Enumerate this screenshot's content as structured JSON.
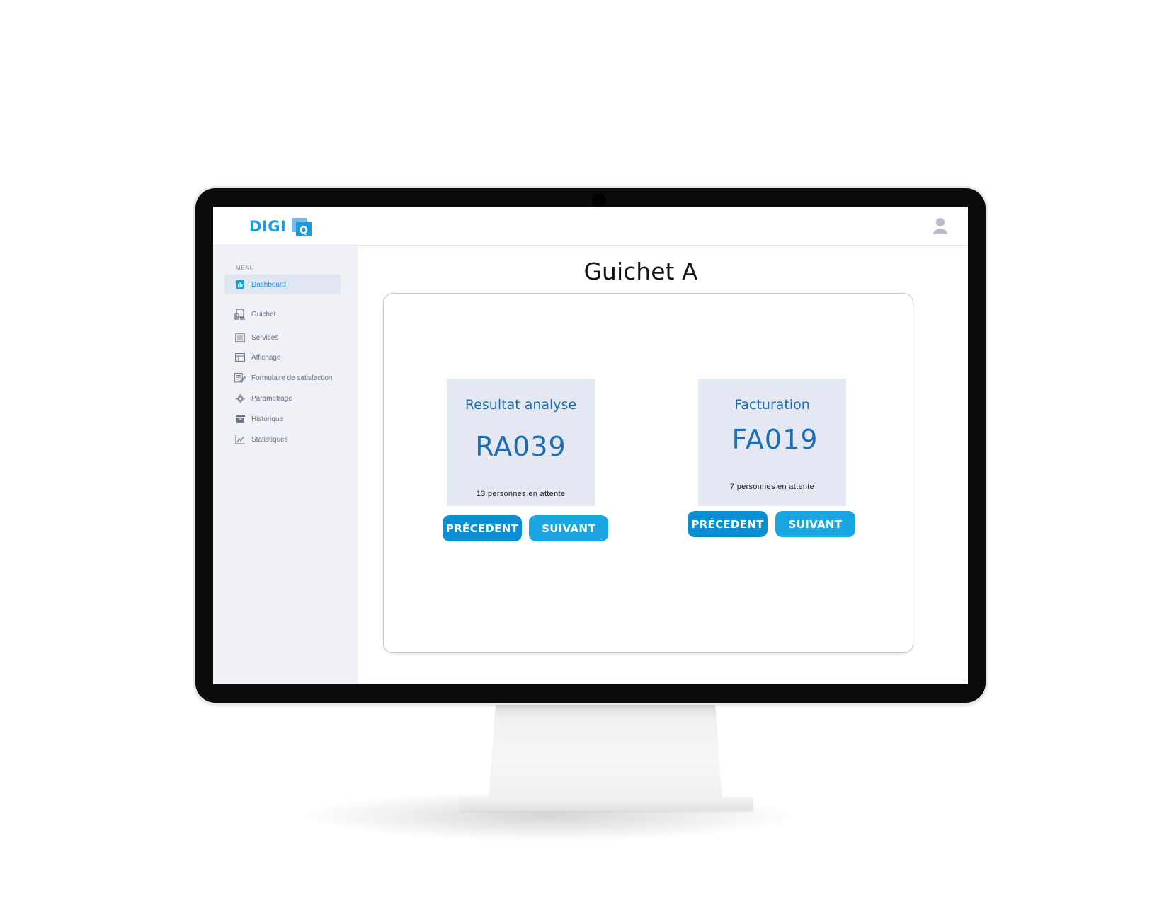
{
  "brand": {
    "name": "DIGI",
    "mark_letter": "Q",
    "color": "#1b9be0"
  },
  "sidebar": {
    "menu_heading": "MENU",
    "items": [
      {
        "label": "Dashboard",
        "icon": "dashboard-icon",
        "active": true
      },
      {
        "label": "Guichet",
        "icon": "kiosk-icon",
        "active": false
      },
      {
        "label": "Services",
        "icon": "list-icon",
        "active": false
      },
      {
        "label": "Affichage",
        "icon": "display-icon",
        "active": false
      },
      {
        "label": "Formulaire de satisfaction",
        "icon": "form-icon",
        "active": false
      },
      {
        "label": "Parametrage",
        "icon": "gear-icon",
        "active": false
      },
      {
        "label": "Historique",
        "icon": "archive-icon",
        "active": false
      },
      {
        "label": "Statistiques",
        "icon": "chart-icon",
        "active": false
      }
    ]
  },
  "topbar": {
    "user_icon": "user-icon"
  },
  "main": {
    "title": "Guichet A",
    "counters": [
      {
        "service": "Resultat analyse",
        "ticket": "RA039",
        "waiting": "13 personnes en attente",
        "prev_label": "PRÉCEDENT",
        "next_label": "SUIVANT"
      },
      {
        "service": "Facturation",
        "ticket": "FA019",
        "waiting": "7 personnes en attente",
        "prev_label": "PRÉCEDENT",
        "next_label": "SUIVANT"
      }
    ]
  },
  "colors": {
    "accent": "#1b9be0",
    "ticket_text": "#1c6db6",
    "ticket_bg": "#e4e8f3",
    "button_prev": "#0a8ed4",
    "button_next": "#1aa6e0"
  }
}
